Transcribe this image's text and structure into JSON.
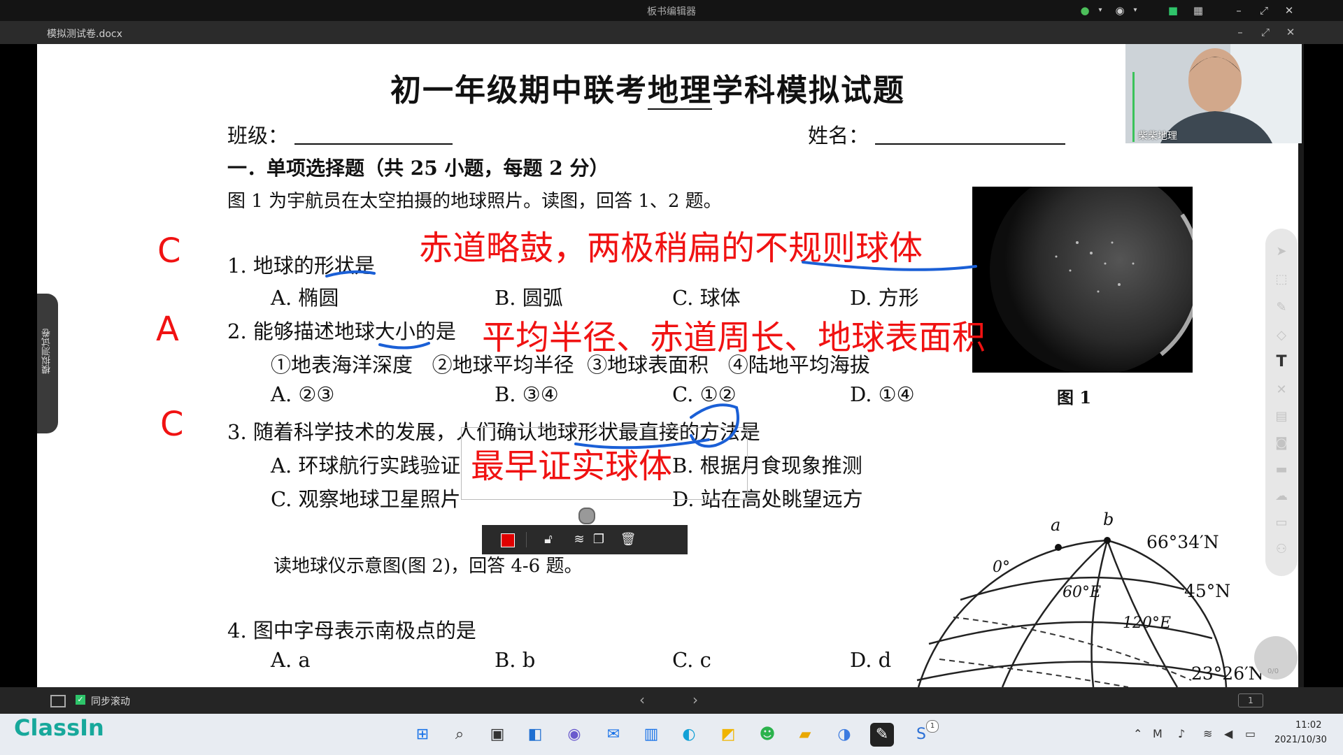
{
  "window": {
    "title": "板书编辑器",
    "doc_name": "模拟测试卷.docx"
  },
  "document": {
    "title_pre": "初一年级期中联考",
    "title_ul": "地理",
    "title_post": "学科模拟试题",
    "class_label": "班级：",
    "name_label": "姓名：",
    "section1": "一．单项选择题（共 25 小题，每题 2 分）",
    "intro1": "图 1 为宇航员在太空拍摄的地球照片。读图，回答 1、2 题。",
    "q1": {
      "pre": "1.  地球的",
      "ul": "形状",
      "post": "是",
      "opts": [
        "A.  椭圆",
        "B. 圆弧",
        "C. 球体",
        "D. 方形"
      ]
    },
    "q2": {
      "pre": "2. 能够描述地球",
      "ul": "大小",
      "post": "的是",
      "items": "①地表海洋深度   ②地球平均半径  ③地球表面积   ④陆地平均海拔",
      "opts": [
        "A.  ②③",
        "B.  ③④",
        "C.  ①②",
        "D.  ①④"
      ]
    },
    "q3": {
      "text": "3. 随着科学技术的发展，人们确认地球形状最直接的方法是",
      "opts": [
        "A. 环球航行实践验证",
        "B. 根据月食现象推测",
        "C. 观察地球卫星照片",
        "D. 站在高处眺望远方"
      ]
    },
    "intro2": "读地球仪示意图(图 2)，回答 4-6 题。",
    "q4": {
      "text": "4. 图中字母表示南极点的是",
      "opts": [
        "A. a",
        "B. b",
        "C. c",
        "D. d"
      ]
    },
    "fig1_caption": "图 1",
    "globe_labels": {
      "a": "a",
      "b": "b",
      "lat1": "66°34′N",
      "lat2": "45°N",
      "lat3": "23°26′N",
      "lon0": "0°",
      "lon60": "60°E",
      "lon120": "120°E"
    }
  },
  "annotations": {
    "ans1": "C",
    "ans2": "A",
    "ans3": "C",
    "note1_pre": "赤道略鼓，两极稍扁的",
    "note1_ul": "不规则球体",
    "note2": "平均半径、赤道周长、地球表面积",
    "note3": "最早证实球体"
  },
  "left_tab": "模拟测试卷",
  "webcam_name": "柴柴地理",
  "right_tools": [
    "cursor-icon",
    "select-icon",
    "pen-icon",
    "eraser-icon",
    "text-icon",
    "close-icon",
    "calendar-icon",
    "camera-icon",
    "video-icon",
    "cloud-icon",
    "box-icon",
    "users-icon"
  ],
  "page_counter": "0/0",
  "bottom": {
    "sync_label": "同步滚动",
    "page_num": "1"
  },
  "taskbar": {
    "brand": "ClassIn",
    "time": "11:02",
    "date": "2021/10/30",
    "notif_count": "1"
  },
  "colors": {
    "annotation_red": "#f01212",
    "annotation_blue": "#1a5fd6",
    "float_color": "#e00000"
  }
}
